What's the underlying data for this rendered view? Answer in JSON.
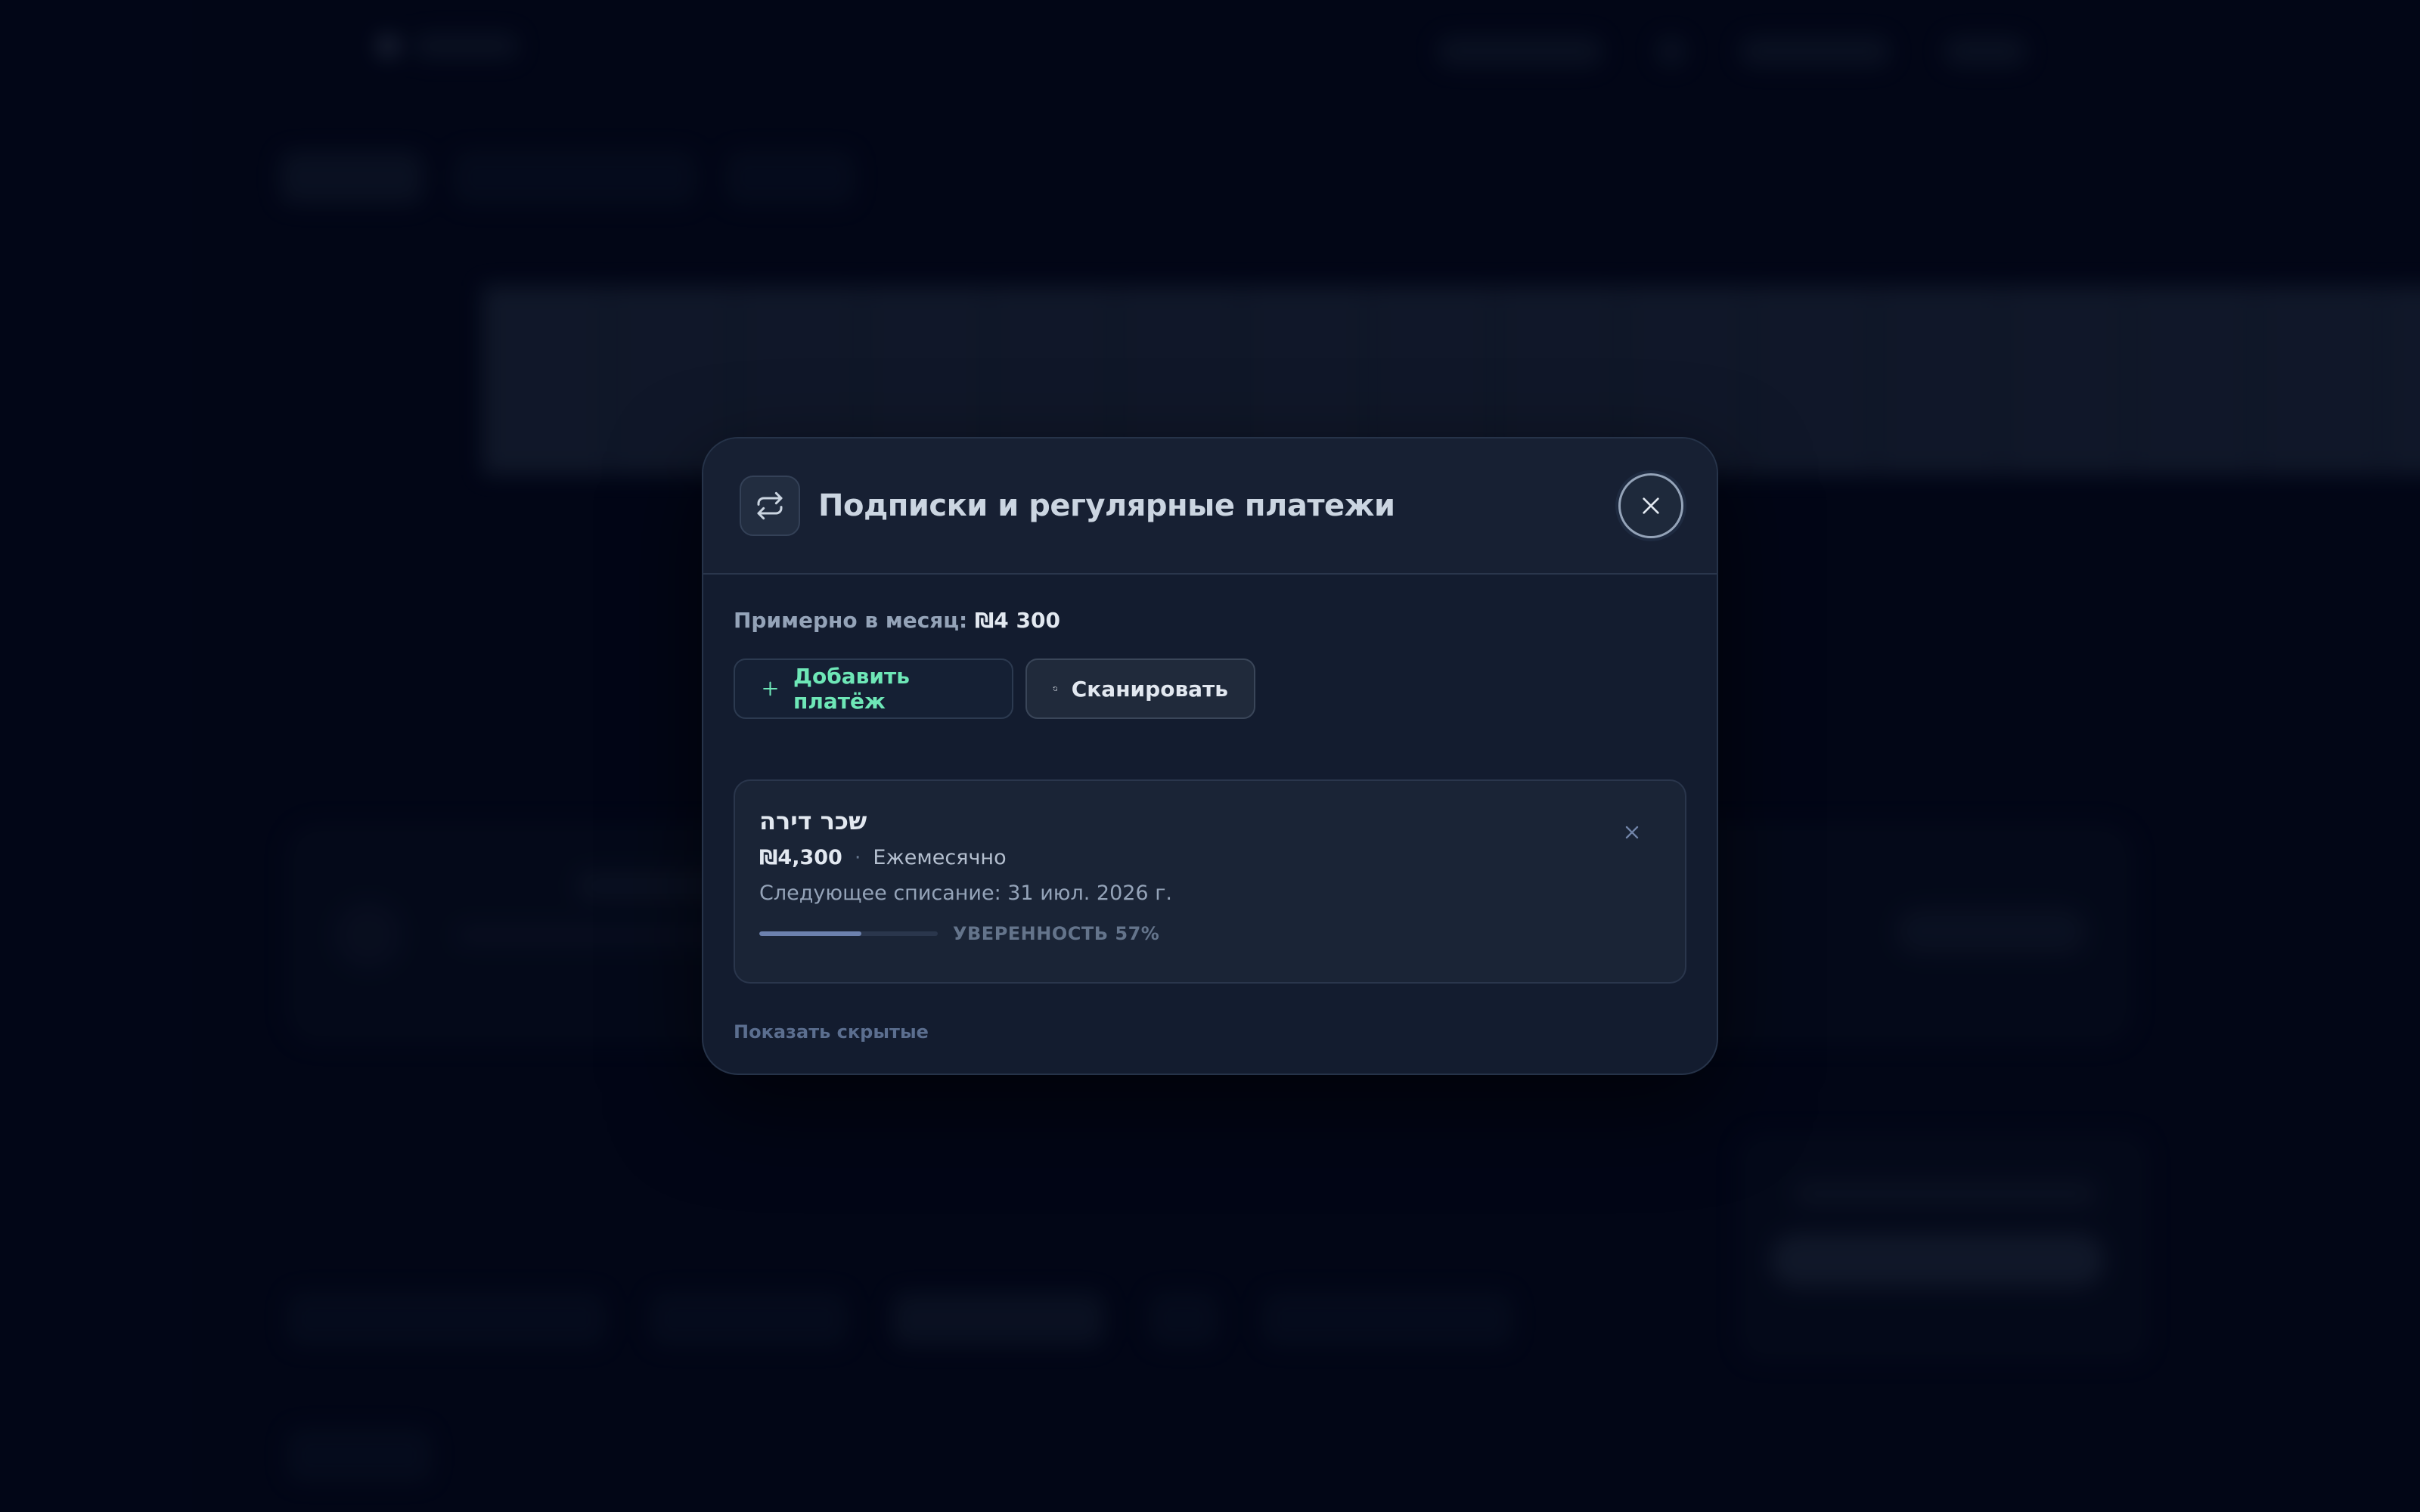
{
  "modal": {
    "title": "Подписки и регулярные платежи",
    "header_icon": "repeat-icon",
    "close_icon": "close-icon",
    "summary_label": "Примерно в месяц:",
    "summary_amount": "₪4 300",
    "add_button_label": "Добавить платёж",
    "scan_button_label": "Сканировать",
    "items": [
      {
        "title": "שכר דירה",
        "price": "₪4,300",
        "separator": "·",
        "frequency": "Ежемесячно",
        "next_charge": "Следующее списание: 31 июл. 2026 г.",
        "confidence_label": "УВЕРЕННОСТЬ 57%",
        "confidence_value": 0.57
      }
    ],
    "show_hidden_label": "Показать скрытые"
  },
  "colors": {
    "accent_green": "#6ee7b7",
    "confidence_fill": "#6c81ae",
    "background": "#020617"
  }
}
